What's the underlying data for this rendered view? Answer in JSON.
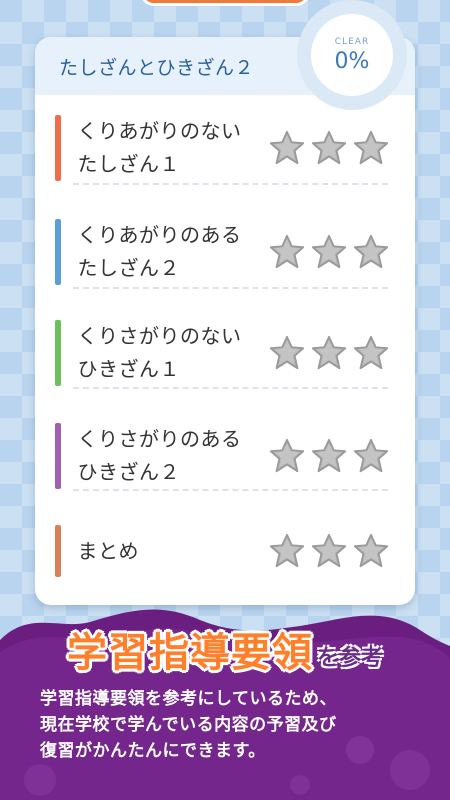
{
  "card": {
    "title": "たしざんとひきざん２",
    "clear_label": "CLEAR",
    "clear_value": "0%"
  },
  "lessons": [
    {
      "title": "くりあがりのない\nたしざん１",
      "color": "#f26b4a",
      "stars": 0,
      "max_stars": 3
    },
    {
      "title": "くりあがりのある\nたしざん２",
      "color": "#5b9fd6",
      "stars": 0,
      "max_stars": 3
    },
    {
      "title": "くりさがりのない\nひきざん１",
      "color": "#6cbf5a",
      "stars": 0,
      "max_stars": 3
    },
    {
      "title": "くりさがりのある\nひきざん２",
      "color": "#a060b0",
      "stars": 0,
      "max_stars": 3
    },
    {
      "title": "まとめ",
      "color": "#d9805a",
      "stars": 0,
      "max_stars": 3
    }
  ],
  "promo": {
    "headline": "学習指導要領",
    "headline_suffix": "を参考",
    "description": "学習指導要領を参考にしているため、\n現在学校で学んでいる内容の予習及び\n復習がかんたんにできます。"
  },
  "colors": {
    "accent": "#ff7f2a",
    "promo_bg": "#6a1f80",
    "star_empty": "#b8b8b8"
  }
}
